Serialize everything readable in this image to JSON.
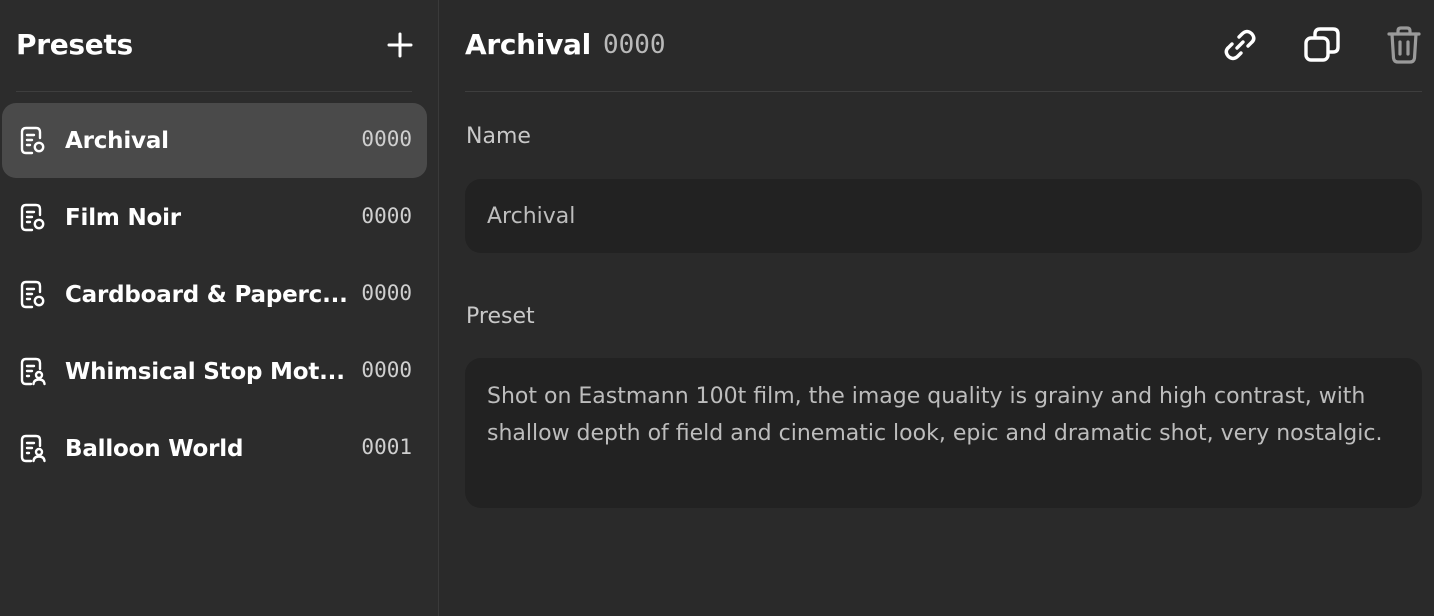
{
  "sidebar": {
    "title": "Presets",
    "add_icon": "plus-icon",
    "items": [
      {
        "label": "Archival",
        "count": "0000",
        "icon": "document-gear-icon",
        "active": true
      },
      {
        "label": "Film Noir",
        "count": "0000",
        "icon": "document-gear-icon",
        "active": false
      },
      {
        "label": "Cardboard & Paperc...",
        "count": "0000",
        "icon": "document-gear-icon",
        "active": false
      },
      {
        "label": "Whimsical Stop Mot...",
        "count": "0000",
        "icon": "document-user-icon",
        "active": false
      },
      {
        "label": "Balloon World",
        "count": "0001",
        "icon": "document-user-icon",
        "active": false
      }
    ]
  },
  "main": {
    "title": "Archival",
    "count": "0000",
    "actions": [
      "link-icon",
      "copy-icon",
      "trash-icon"
    ],
    "name_label": "Name",
    "name_value": "Archival",
    "preset_label": "Preset",
    "preset_value": "Shot on Eastmann 100t film, the image quality is grainy and high contrast, with shallow depth of field and cinematic look, epic and dramatic shot, very nostalgic."
  },
  "colors": {
    "background": "#2b2b2b",
    "active_item": "#4a4a4a",
    "input_bg": "#222222",
    "text": "#ffffff",
    "muted_text": "#bdbdbd"
  }
}
